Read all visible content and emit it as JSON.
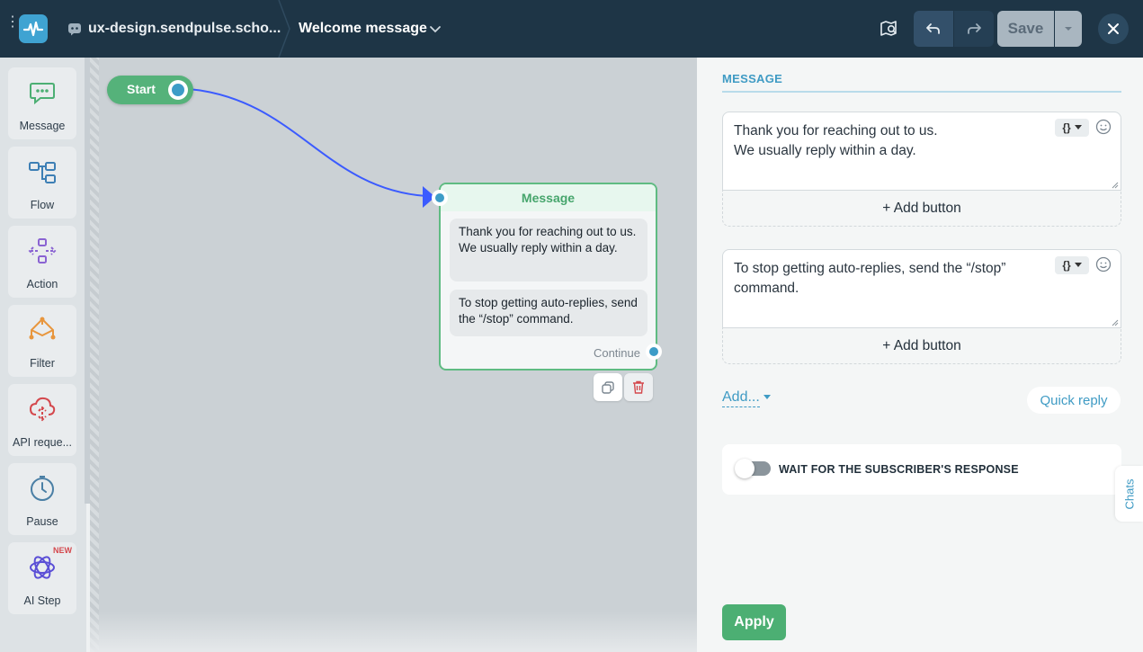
{
  "topbar": {
    "bot_name": "ux-design.sendpulse.scho...",
    "flow_name": "Welcome message",
    "save_label": "Save"
  },
  "palette": {
    "items": [
      {
        "label": "Message",
        "icon": "message-bubble-icon"
      },
      {
        "label": "Flow",
        "icon": "flow-icon"
      },
      {
        "label": "Action",
        "icon": "action-icon"
      },
      {
        "label": "Filter",
        "icon": "filter-icon"
      },
      {
        "label": "API reque...",
        "icon": "api-request-icon"
      },
      {
        "label": "Pause",
        "icon": "clock-icon"
      },
      {
        "label": "AI Step",
        "icon": "ai-step-icon"
      }
    ],
    "new_badge": "NEW"
  },
  "canvas": {
    "start_label": "Start",
    "message_node": {
      "title": "Message",
      "bubbles": [
        "Thank you for reaching out to us.\nWe usually reply within a day.",
        "To stop getting auto-replies, send the “/stop” command."
      ],
      "continue_label": "Continue"
    }
  },
  "panel": {
    "title": "MESSAGE",
    "messages": [
      {
        "text": "Thank you for reaching out to us.\nWe usually reply within a day.",
        "add_button_label": "+ Add button",
        "variable_label": "{}"
      },
      {
        "text": "To stop getting auto-replies, send the “/stop” command.",
        "add_button_label": "+ Add button",
        "variable_label": "{}"
      }
    ],
    "add_more_label": "Add...",
    "quick_reply_label": "Quick reply",
    "wait_label": "WAIT FOR THE SUBSCRIBER'S RESPONSE",
    "wait_enabled": false,
    "apply_label": "Apply"
  },
  "chats_tab_label": "Chats",
  "colors": {
    "topbar_bg": "#1e3546",
    "accent_blue": "#3f9bc4",
    "node_green": "#55b27a",
    "connector_blue": "#3b5bff",
    "apply_green": "#4caf73"
  }
}
